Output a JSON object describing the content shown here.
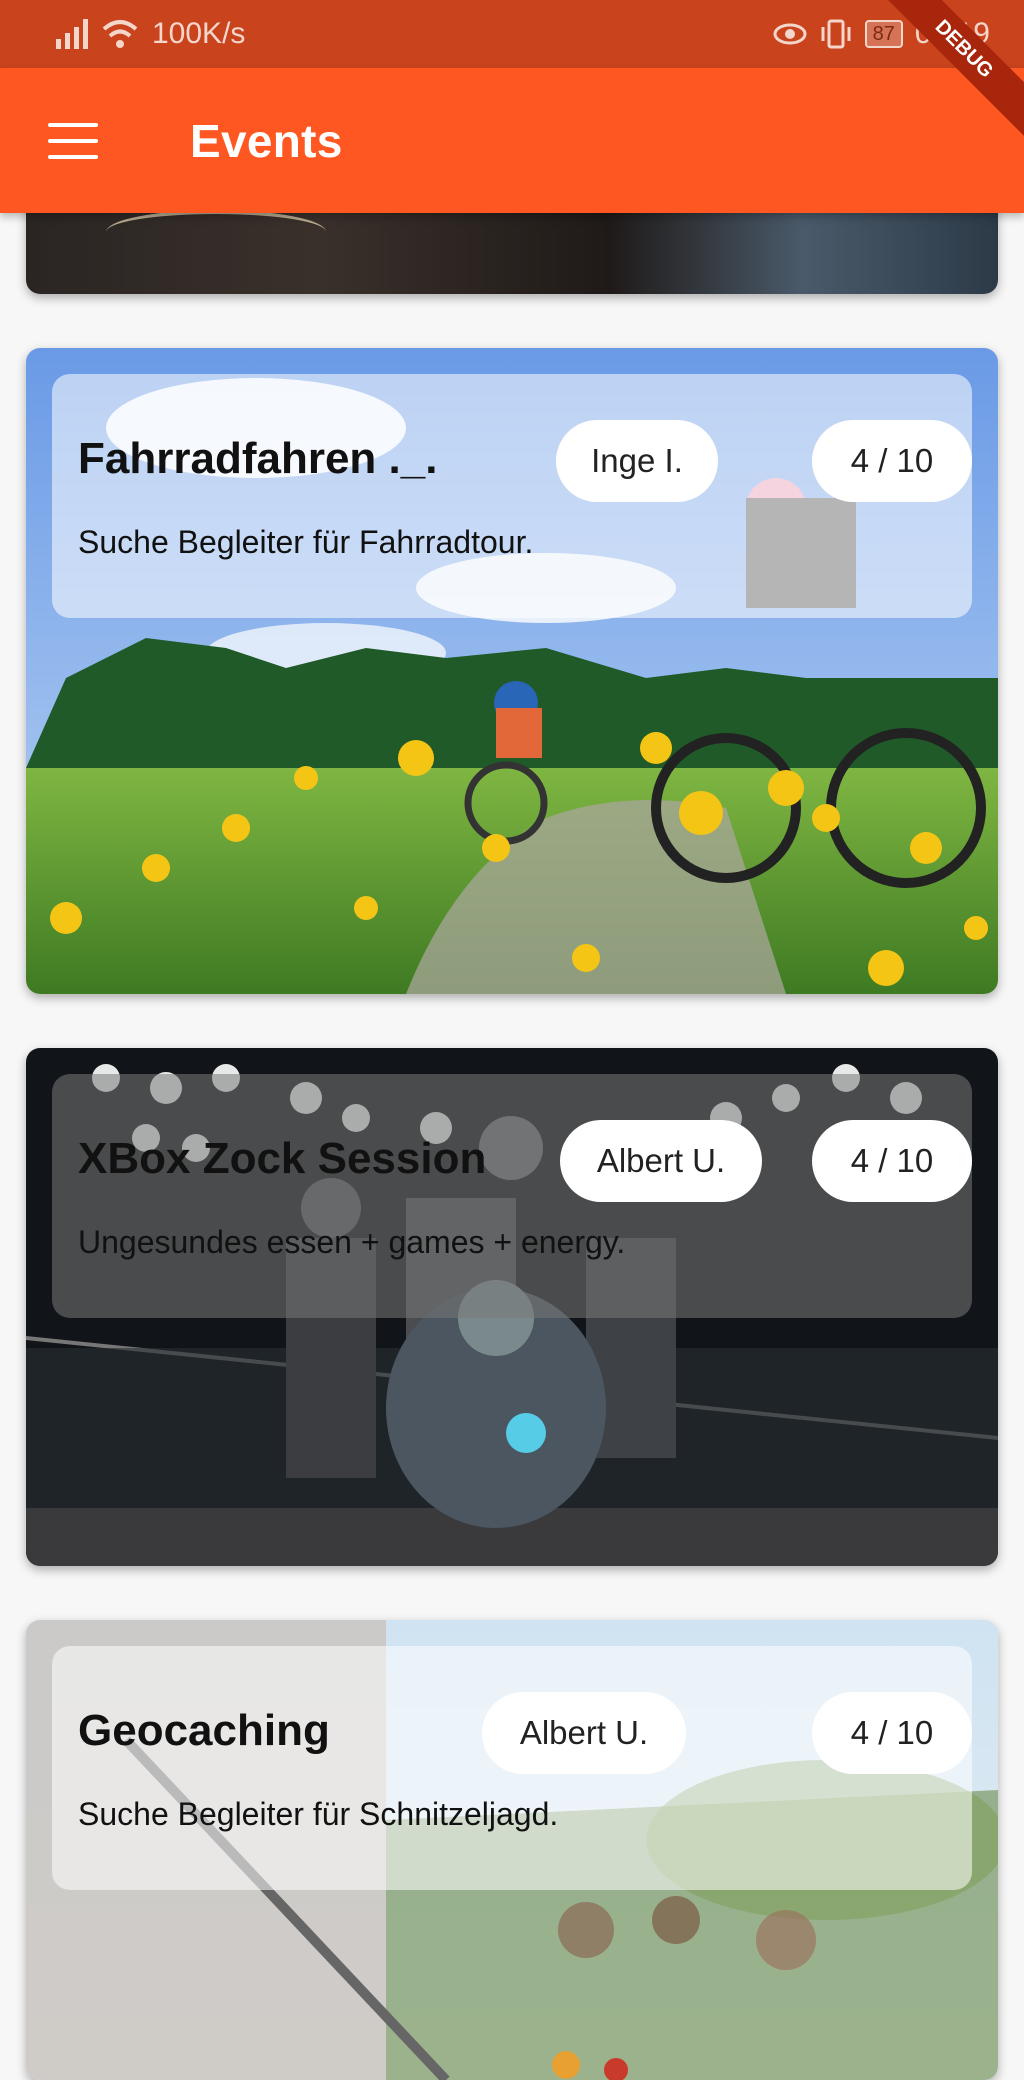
{
  "status_bar": {
    "speed": "100K/s",
    "battery": "87",
    "time": "09:19"
  },
  "app_bar": {
    "title": "Events",
    "debug_label": "DEBUG"
  },
  "events": [
    {
      "title": "Fahrradfahren ._.",
      "organizer": "Inge I.",
      "participants": "4 / 10",
      "description": "Suche Begleiter für Fahrradtour."
    },
    {
      "title": "XBox Zock Session",
      "organizer": "Albert U.",
      "participants": "4 / 10",
      "description": "Ungesundes essen + games + energy."
    },
    {
      "title": "Geocaching",
      "organizer": "Albert U.",
      "participants": "4 / 10",
      "description": "Suche Begleiter für Schnitzeljagd."
    }
  ],
  "colors": {
    "primary": "#fe5722",
    "status_bar": "#c9431d"
  }
}
